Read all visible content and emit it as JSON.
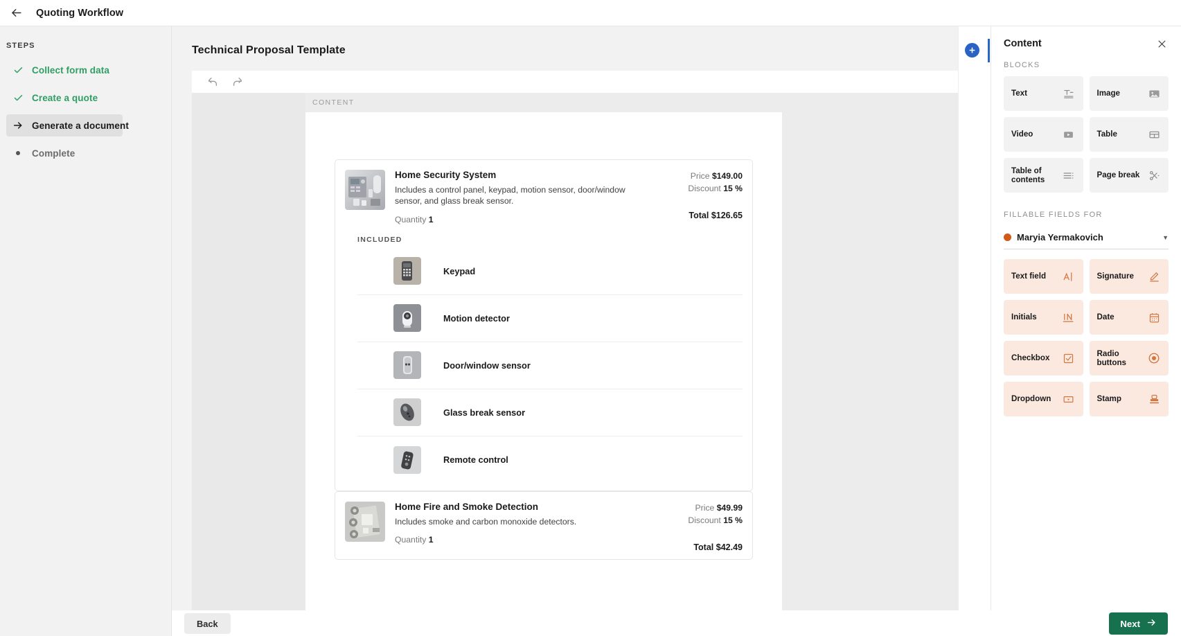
{
  "topbar": {
    "title": "Quoting Workflow",
    "back_icon": "arrow-left-icon"
  },
  "sidebar": {
    "section_label": "STEPS",
    "steps": [
      {
        "label": "Collect form data",
        "state": "done",
        "icon": "check-icon"
      },
      {
        "label": "Create a quote",
        "state": "done",
        "icon": "check-icon"
      },
      {
        "label": "Generate a document",
        "state": "current",
        "icon": "arrow-right-icon"
      },
      {
        "label": "Complete",
        "state": "todo",
        "icon": "dot-icon"
      }
    ]
  },
  "editor": {
    "document_title": "Technical Proposal Template",
    "toolbar": [
      {
        "name": "undo-button",
        "icon": "undo-icon"
      },
      {
        "name": "redo-button",
        "icon": "redo-icon"
      }
    ],
    "canvas_section_label": "CONTENT"
  },
  "document": {
    "products": [
      {
        "name": "Home Security System",
        "description": "Includes a control panel, keypad, motion sensor, door/window sensor, and glass break sensor.",
        "price_label": "Price",
        "price": "$149.00",
        "discount_label": "Discount",
        "discount": "15 %",
        "quantity_label": "Quantity",
        "quantity": "1",
        "total_label": "Total",
        "total": "$126.65",
        "included_label": "INCLUDED",
        "included": [
          {
            "name": "Keypad"
          },
          {
            "name": "Motion detector"
          },
          {
            "name": "Door/window sensor"
          },
          {
            "name": "Glass break sensor"
          },
          {
            "name": "Remote control"
          }
        ]
      },
      {
        "name": "Home Fire and Smoke Detection",
        "description": "Includes smoke and carbon monoxide detectors.",
        "price_label": "Price",
        "price": "$49.99",
        "discount_label": "Discount",
        "discount": "15 %",
        "quantity_label": "Quantity",
        "quantity": "1",
        "total_label": "Total",
        "total": "$42.49"
      }
    ]
  },
  "add_strip": {
    "plus_label": "+",
    "plus_icon": "plus-circle-icon"
  },
  "right_panel": {
    "title": "Content",
    "close_icon": "close-icon",
    "blocks_label": "BLOCKS",
    "blocks": [
      {
        "label": "Text",
        "icon": "text-block-icon"
      },
      {
        "label": "Image",
        "icon": "image-icon"
      },
      {
        "label": "Video",
        "icon": "video-icon"
      },
      {
        "label": "Table",
        "icon": "table-icon"
      },
      {
        "label": "Table of contents",
        "icon": "toc-icon"
      },
      {
        "label": "Page break",
        "icon": "scissors-icon"
      }
    ],
    "fillable_label": "FILLABLE FIELDS FOR",
    "recipient": {
      "name": "Maryia Yermakovich",
      "dot_color": "#cf5a1a",
      "caret_icon": "chevron-down-icon"
    },
    "fields": [
      {
        "label": "Text field",
        "icon": "text-field-icon"
      },
      {
        "label": "Signature",
        "icon": "signature-icon"
      },
      {
        "label": "Initials",
        "icon": "initials-icon"
      },
      {
        "label": "Date",
        "icon": "calendar-icon"
      },
      {
        "label": "Checkbox",
        "icon": "checkbox-icon"
      },
      {
        "label": "Radio buttons",
        "icon": "radio-icon"
      },
      {
        "label": "Dropdown",
        "icon": "dropdown-icon"
      },
      {
        "label": "Stamp",
        "icon": "stamp-icon"
      }
    ]
  },
  "footer": {
    "back_label": "Back",
    "next_label": "Next",
    "next_icon": "arrow-right-icon"
  },
  "colors": {
    "green": "#17714e",
    "step_done_green": "#2e9e63",
    "blue": "#2b63c4",
    "field_orange": "#d2763f",
    "field_bg": "#fbe9e0"
  }
}
